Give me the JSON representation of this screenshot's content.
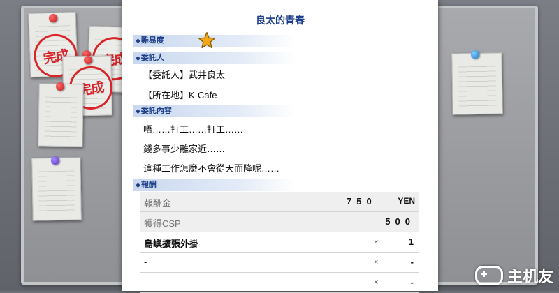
{
  "quest": {
    "title": "良太的青春",
    "difficulty": {
      "header": "難易度",
      "stars": 1
    },
    "client": {
      "header": "委託人",
      "name_line": "【委託人】武井良太",
      "location_line": "【所在地】K-Cafe"
    },
    "content": {
      "header": "委託內容",
      "lines": [
        "唔……打工……打工……",
        "錢多事少離家近……",
        "這種工作怎麼不會從天而降呢……"
      ]
    },
    "reward": {
      "header": "報酬",
      "rows": [
        {
          "name": "報酬金",
          "value": "750",
          "unit": "YEN"
        },
        {
          "name": "獲得CSP",
          "value": "500"
        },
        {
          "name": "島嶼擴張外掛",
          "times": "×",
          "qty": "1"
        },
        {
          "name": "-",
          "times": "×",
          "qty": "-"
        },
        {
          "name": "-",
          "times": "×",
          "qty": "-"
        }
      ]
    }
  },
  "board": {
    "stamp_text": "完成"
  },
  "watermark": {
    "text": "主机友"
  },
  "colors": {
    "accent": "#1e3f8a",
    "stamp": "#d8262a",
    "star": "#f2a818"
  }
}
